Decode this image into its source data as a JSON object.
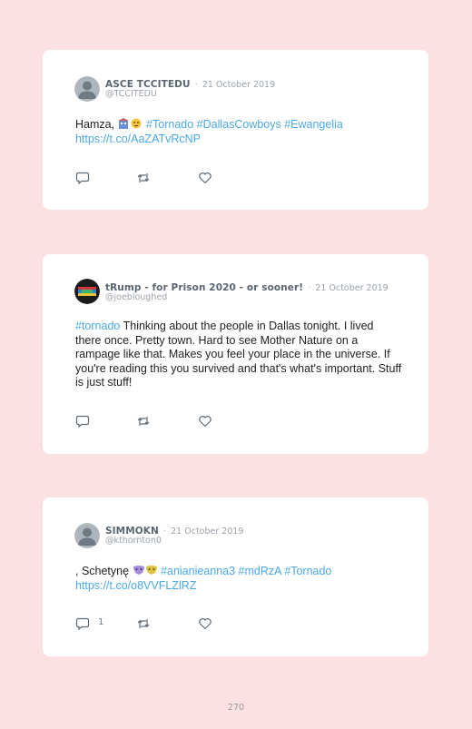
{
  "tweets": [
    {
      "author_name": "ASCE TCCITEDU",
      "separator": "·",
      "date": "21 October 2019",
      "handle": "@TCCITEDU",
      "text_plain_1": "Hamza,",
      "emoji": "building-face-emoji",
      "hashtags": "#Tornado #DallasCowboys #Ewangelia",
      "url": "https://t.co/AaZATvRcNP",
      "avatar_icon": "default-avatar-icon",
      "reply_count": ""
    },
    {
      "author_name": "tRump - for Prison 2020 - or sooner!",
      "separator": "·",
      "date": "21 October 2019",
      "handle": "@joebloughed",
      "hashtag": "#tornado",
      "text": " Thinking about the people in Dallas tonight. I lived there once. Pretty town. Hard to see Mother Nature on a rampage like that. Makes you feel your place in the universe. If you're reading this you survived and that's what's important. Stuff is just stuff!",
      "avatar_icon": "custom-avatar-icon",
      "reply_count": ""
    },
    {
      "author_name": "SIMMOKN",
      "separator": "·",
      "date": "21 October 2019",
      "handle": "@kthornton0",
      "text_plain_1": ", Schetynę",
      "emoji": "masks-emoji",
      "hashtags": "#anianieanna3 #mdRzA #Tornado",
      "url": "https://t.co/o8VVFLZlRZ",
      "avatar_icon": "default-avatar-icon",
      "reply_count": "1"
    }
  ],
  "icons": {
    "reply": "reply-icon",
    "retweet": "retweet-icon",
    "like": "heart-icon"
  },
  "colors": {
    "background": "#fbe1e1",
    "link": "#4aa8e6",
    "card": "#ffffff"
  },
  "page_number": "270"
}
